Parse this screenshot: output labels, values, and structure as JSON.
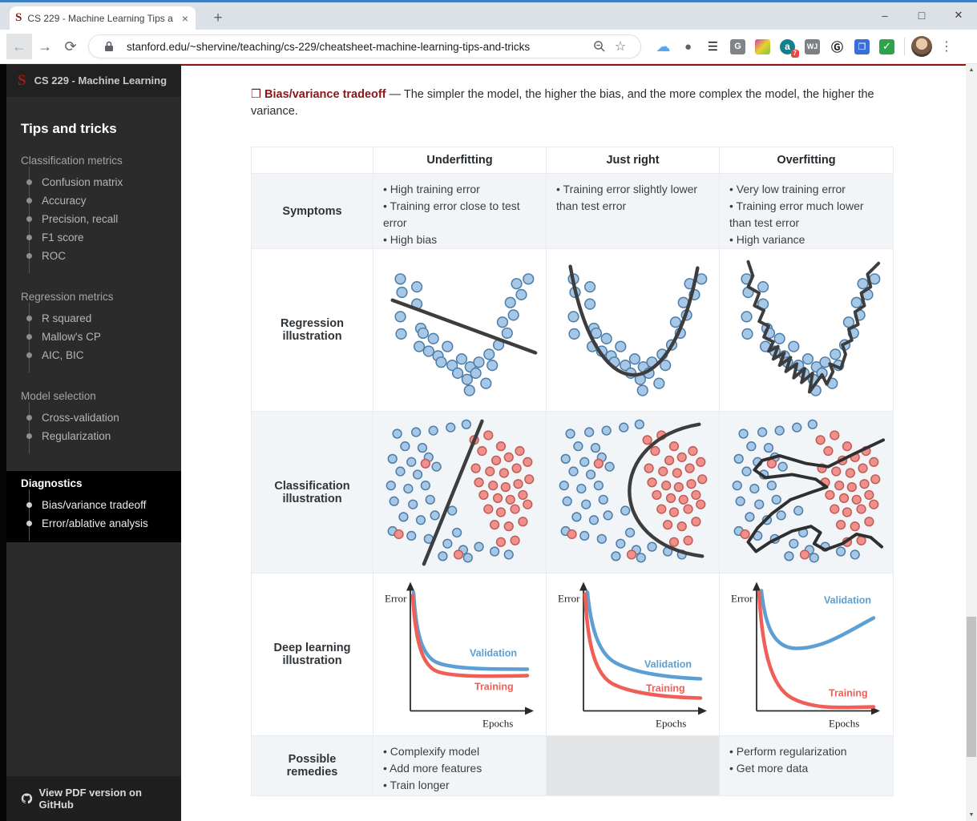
{
  "window_controls": {
    "minimize": "–",
    "maximize": "□",
    "close": "✕"
  },
  "browser": {
    "tab_title": "CS 229 - Machine Learning Tips a",
    "tab_close": "×",
    "new_tab": "+",
    "back": "←",
    "forward": "→",
    "reload": "⟳",
    "url": "stanford.edu/~shervine/teaching/cs-229/cheatsheet-machine-learning-tips-and-tricks",
    "star": "☆",
    "menu": "⋮",
    "extensions": [
      {
        "name": "cloud-extension",
        "glyph": "☁"
      },
      {
        "name": "circle-extension",
        "glyph": "●"
      },
      {
        "name": "layers-extension",
        "glyph": "☰"
      },
      {
        "name": "g-extension",
        "glyph": "G"
      },
      {
        "name": "cube-extension",
        "glyph": ""
      },
      {
        "name": "annotator-extension",
        "glyph": "a",
        "badge": "7"
      },
      {
        "name": "wsj-extension",
        "glyph": "WJ"
      },
      {
        "name": "scholar-extension",
        "glyph": "Ⓖ"
      },
      {
        "name": "notes-extension",
        "glyph": "❐"
      },
      {
        "name": "check-extension",
        "glyph": "✓"
      }
    ]
  },
  "sidebar": {
    "logo": "S",
    "title": "CS 229 - Machine Learning",
    "heading": "Tips and tricks",
    "sections": [
      {
        "label": "Classification metrics",
        "items": [
          "Confusion matrix",
          "Accuracy",
          "Precision, recall",
          "F1 score",
          "ROC"
        ]
      },
      {
        "label": "Regression metrics",
        "items": [
          "R squared",
          "Mallow's CP",
          "AIC, BIC"
        ]
      },
      {
        "label": "Model selection",
        "items": [
          "Cross-validation",
          "Regularization"
        ]
      },
      {
        "label": "Diagnostics",
        "items": [
          "Bias/variance tradeoff",
          "Error/ablative analysis"
        ]
      }
    ],
    "footer": "View PDF version on GitHub"
  },
  "content": {
    "intro": {
      "marker": "❒",
      "title": "Bias/variance tradeoff",
      "text": "— The simpler the model, the higher the bias, and the more complex the model, the higher the variance."
    },
    "table": {
      "columns": [
        "Underfitting",
        "Just right",
        "Overfitting"
      ],
      "row_labels": {
        "symptoms": "Symptoms",
        "regression": "Regression illustration",
        "classification": "Classification illustration",
        "deep_learning": "Deep learning illustration",
        "remedies": "Possible remedies"
      },
      "symptoms": {
        "underfitting": [
          "High training error",
          "Training error close to test error",
          "High bias"
        ],
        "just_right": [
          "Training error slightly lower than test error"
        ],
        "overfitting": [
          "Very low training error",
          "Training error much lower than test error",
          "High variance"
        ]
      },
      "deep_learning_labels": {
        "y_axis": "Error",
        "x_axis": "Epochs",
        "validation": "Validation",
        "training": "Training"
      },
      "remedies": {
        "underfitting": [
          "Complexify model",
          "Add more features",
          "Train longer"
        ],
        "just_right": [],
        "overfitting": [
          "Perform regularization",
          "Get more data"
        ]
      }
    }
  },
  "colors": {
    "stanford_maroon": "#8C1515",
    "row_stripe": "#f2f5f8",
    "disabled_cell": "#e3e4e6",
    "dot_blue_fill": "#a7c7e7",
    "dot_blue_stroke": "#4a7ba6",
    "dot_red_fill": "#f0908a",
    "dot_red_stroke": "#c05a55",
    "boundary_line": "#3d3d3d",
    "validation_blue": "#5b9fd4",
    "training_red": "#ef5f58",
    "sidebar_bg": "#2b2b2b",
    "active_section_bg": "#000000"
  }
}
